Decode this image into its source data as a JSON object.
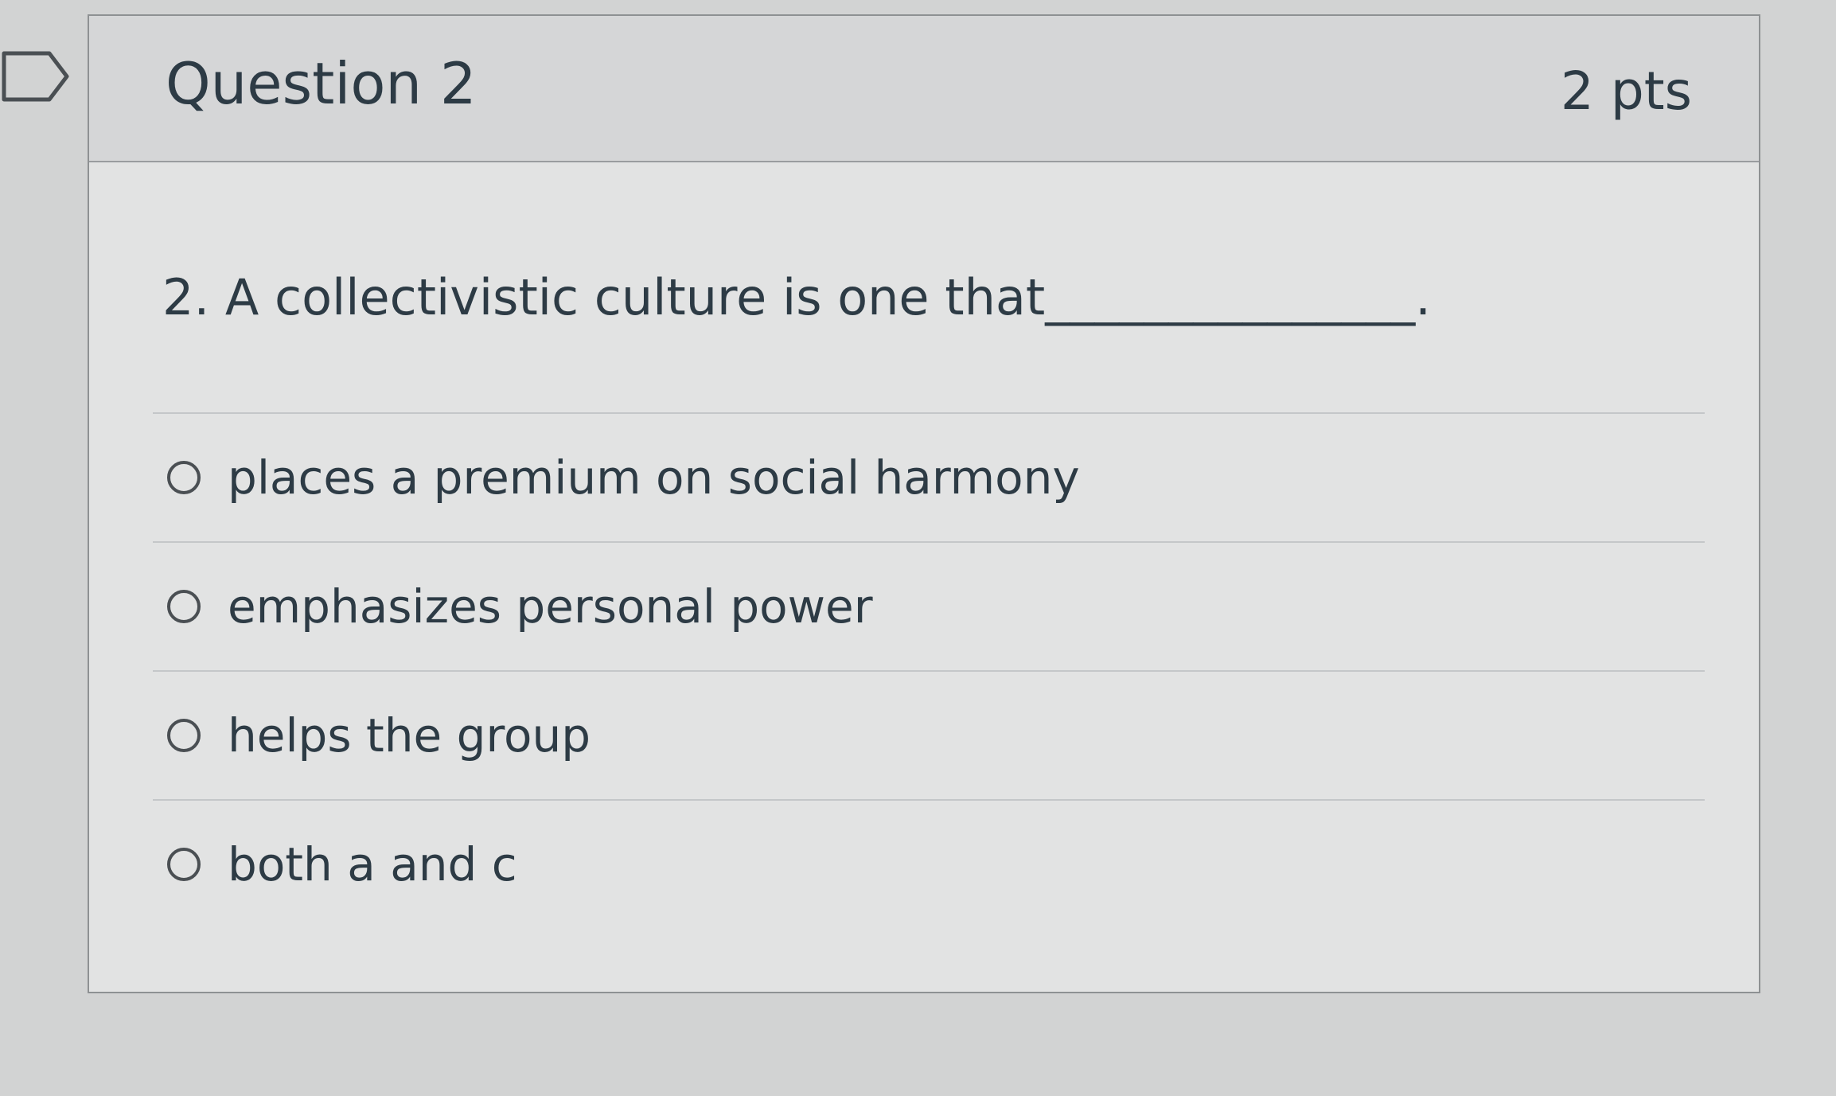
{
  "question": {
    "title": "Question 2",
    "points": "2 pts",
    "text": "2. A collectivistic culture is one that_______________."
  },
  "answers": [
    {
      "label": "places a premium on social harmony",
      "selected": false
    },
    {
      "label": "emphasizes personal power",
      "selected": false
    },
    {
      "label": "helps the group",
      "selected": false
    },
    {
      "label": "both a and c",
      "selected": false
    }
  ],
  "icons": {
    "flag": "bookmark-flag-icon"
  }
}
